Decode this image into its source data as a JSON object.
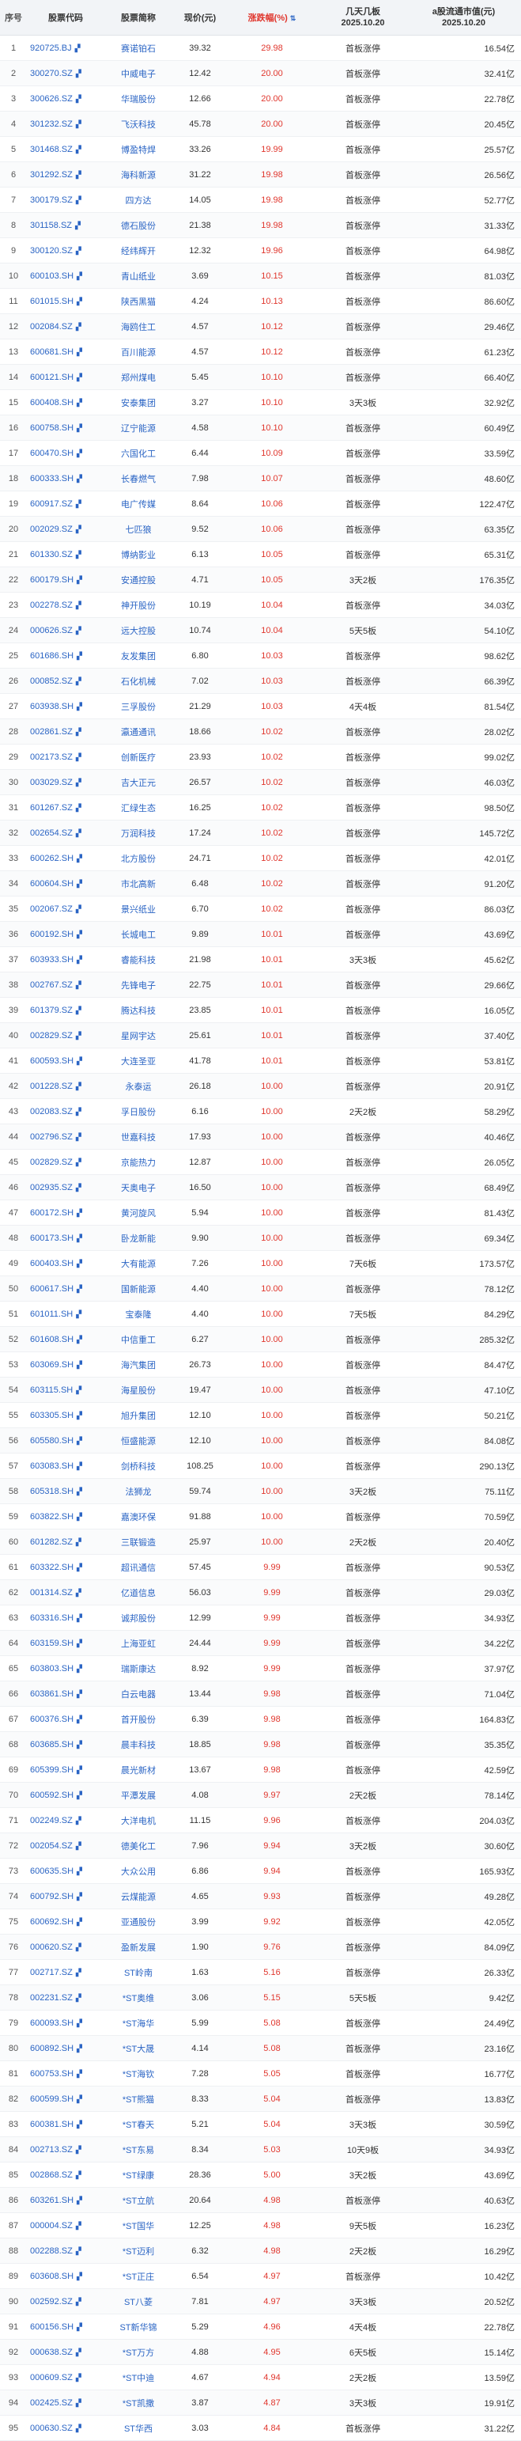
{
  "columns": {
    "idx": "序号",
    "code": "股票代码",
    "name": "股票简称",
    "price": "现价(元)",
    "pct": "涨跌幅(%)",
    "times": "几天几板\n2025.10.20",
    "mcap": "a股流通市值(元)\n2025.10.20",
    "sort_icon": "sort-arrow-icon"
  },
  "rows": [
    {
      "idx": "1",
      "code": "920725.BJ",
      "name": "赛诺铂石",
      "price": "39.32",
      "pct": "29.98",
      "times": "首板涨停",
      "mcap": "16.54亿"
    },
    {
      "idx": "2",
      "code": "300270.SZ",
      "name": "中威电子",
      "price": "12.42",
      "pct": "20.00",
      "times": "首板涨停",
      "mcap": "32.41亿"
    },
    {
      "idx": "3",
      "code": "300626.SZ",
      "name": "华瑞股份",
      "price": "12.66",
      "pct": "20.00",
      "times": "首板涨停",
      "mcap": "22.78亿"
    },
    {
      "idx": "4",
      "code": "301232.SZ",
      "name": "飞沃科技",
      "price": "45.78",
      "pct": "20.00",
      "times": "首板涨停",
      "mcap": "20.45亿"
    },
    {
      "idx": "5",
      "code": "301468.SZ",
      "name": "博盈特焊",
      "price": "33.26",
      "pct": "19.99",
      "times": "首板涨停",
      "mcap": "25.57亿"
    },
    {
      "idx": "6",
      "code": "301292.SZ",
      "name": "海科新源",
      "price": "31.22",
      "pct": "19.98",
      "times": "首板涨停",
      "mcap": "26.56亿"
    },
    {
      "idx": "7",
      "code": "300179.SZ",
      "name": "四方达",
      "price": "14.05",
      "pct": "19.98",
      "times": "首板涨停",
      "mcap": "52.77亿"
    },
    {
      "idx": "8",
      "code": "301158.SZ",
      "name": "德石股份",
      "price": "21.38",
      "pct": "19.98",
      "times": "首板涨停",
      "mcap": "31.33亿"
    },
    {
      "idx": "9",
      "code": "300120.SZ",
      "name": "经纬辉开",
      "price": "12.32",
      "pct": "19.96",
      "times": "首板涨停",
      "mcap": "64.98亿"
    },
    {
      "idx": "10",
      "code": "600103.SH",
      "name": "青山纸业",
      "price": "3.69",
      "pct": "10.15",
      "times": "首板涨停",
      "mcap": "81.03亿"
    },
    {
      "idx": "11",
      "code": "601015.SH",
      "name": "陕西黑猫",
      "price": "4.24",
      "pct": "10.13",
      "times": "首板涨停",
      "mcap": "86.60亿"
    },
    {
      "idx": "12",
      "code": "002084.SZ",
      "name": "海鸥住工",
      "price": "4.57",
      "pct": "10.12",
      "times": "首板涨停",
      "mcap": "29.46亿"
    },
    {
      "idx": "13",
      "code": "600681.SH",
      "name": "百川能源",
      "price": "4.57",
      "pct": "10.12",
      "times": "首板涨停",
      "mcap": "61.23亿"
    },
    {
      "idx": "14",
      "code": "600121.SH",
      "name": "郑州煤电",
      "price": "5.45",
      "pct": "10.10",
      "times": "首板涨停",
      "mcap": "66.40亿"
    },
    {
      "idx": "15",
      "code": "600408.SH",
      "name": "安泰集团",
      "price": "3.27",
      "pct": "10.10",
      "times": "3天3板",
      "mcap": "32.92亿"
    },
    {
      "idx": "16",
      "code": "600758.SH",
      "name": "辽宁能源",
      "price": "4.58",
      "pct": "10.10",
      "times": "首板涨停",
      "mcap": "60.49亿"
    },
    {
      "idx": "17",
      "code": "600470.SH",
      "name": "六国化工",
      "price": "6.44",
      "pct": "10.09",
      "times": "首板涨停",
      "mcap": "33.59亿"
    },
    {
      "idx": "18",
      "code": "600333.SH",
      "name": "长春燃气",
      "price": "7.98",
      "pct": "10.07",
      "times": "首板涨停",
      "mcap": "48.60亿"
    },
    {
      "idx": "19",
      "code": "600917.SZ",
      "name": "电广传媒",
      "price": "8.64",
      "pct": "10.06",
      "times": "首板涨停",
      "mcap": "122.47亿"
    },
    {
      "idx": "20",
      "code": "002029.SZ",
      "name": "七匹狼",
      "price": "9.52",
      "pct": "10.06",
      "times": "首板涨停",
      "mcap": "63.35亿"
    },
    {
      "idx": "21",
      "code": "601330.SZ",
      "name": "博纳影业",
      "price": "6.13",
      "pct": "10.05",
      "times": "首板涨停",
      "mcap": "65.31亿"
    },
    {
      "idx": "22",
      "code": "600179.SH",
      "name": "安通控股",
      "price": "4.71",
      "pct": "10.05",
      "times": "3天2板",
      "mcap": "176.35亿"
    },
    {
      "idx": "23",
      "code": "002278.SZ",
      "name": "神开股份",
      "price": "10.19",
      "pct": "10.04",
      "times": "首板涨停",
      "mcap": "34.03亿"
    },
    {
      "idx": "24",
      "code": "000626.SZ",
      "name": "远大控股",
      "price": "10.74",
      "pct": "10.04",
      "times": "5天5板",
      "mcap": "54.10亿"
    },
    {
      "idx": "25",
      "code": "601686.SH",
      "name": "友发集团",
      "price": "6.80",
      "pct": "10.03",
      "times": "首板涨停",
      "mcap": "98.62亿"
    },
    {
      "idx": "26",
      "code": "000852.SZ",
      "name": "石化机械",
      "price": "7.02",
      "pct": "10.03",
      "times": "首板涨停",
      "mcap": "66.39亿"
    },
    {
      "idx": "27",
      "code": "603938.SH",
      "name": "三孚股份",
      "price": "21.29",
      "pct": "10.03",
      "times": "4天4板",
      "mcap": "81.54亿"
    },
    {
      "idx": "28",
      "code": "002861.SZ",
      "name": "瀛通通讯",
      "price": "18.66",
      "pct": "10.02",
      "times": "首板涨停",
      "mcap": "28.02亿"
    },
    {
      "idx": "29",
      "code": "002173.SZ",
      "name": "创新医疗",
      "price": "23.93",
      "pct": "10.02",
      "times": "首板涨停",
      "mcap": "99.02亿"
    },
    {
      "idx": "30",
      "code": "003029.SZ",
      "name": "吉大正元",
      "price": "26.57",
      "pct": "10.02",
      "times": "首板涨停",
      "mcap": "46.03亿"
    },
    {
      "idx": "31",
      "code": "601267.SZ",
      "name": "汇绿生态",
      "price": "16.25",
      "pct": "10.02",
      "times": "首板涨停",
      "mcap": "98.50亿"
    },
    {
      "idx": "32",
      "code": "002654.SZ",
      "name": "万润科技",
      "price": "17.24",
      "pct": "10.02",
      "times": "首板涨停",
      "mcap": "145.72亿"
    },
    {
      "idx": "33",
      "code": "600262.SH",
      "name": "北方股份",
      "price": "24.71",
      "pct": "10.02",
      "times": "首板涨停",
      "mcap": "42.01亿"
    },
    {
      "idx": "34",
      "code": "600604.SH",
      "name": "市北高新",
      "price": "6.48",
      "pct": "10.02",
      "times": "首板涨停",
      "mcap": "91.20亿"
    },
    {
      "idx": "35",
      "code": "002067.SZ",
      "name": "景兴纸业",
      "price": "6.70",
      "pct": "10.02",
      "times": "首板涨停",
      "mcap": "86.03亿"
    },
    {
      "idx": "36",
      "code": "600192.SH",
      "name": "长城电工",
      "price": "9.89",
      "pct": "10.01",
      "times": "首板涨停",
      "mcap": "43.69亿"
    },
    {
      "idx": "37",
      "code": "603933.SH",
      "name": "睿能科技",
      "price": "21.98",
      "pct": "10.01",
      "times": "3天3板",
      "mcap": "45.62亿"
    },
    {
      "idx": "38",
      "code": "002767.SZ",
      "name": "先锋电子",
      "price": "22.75",
      "pct": "10.01",
      "times": "首板涨停",
      "mcap": "29.66亿"
    },
    {
      "idx": "39",
      "code": "601379.SZ",
      "name": "腾达科技",
      "price": "23.85",
      "pct": "10.01",
      "times": "首板涨停",
      "mcap": "16.05亿"
    },
    {
      "idx": "40",
      "code": "002829.SZ",
      "name": "星网宇达",
      "price": "25.61",
      "pct": "10.01",
      "times": "首板涨停",
      "mcap": "37.40亿"
    },
    {
      "idx": "41",
      "code": "600593.SH",
      "name": "大连圣亚",
      "price": "41.78",
      "pct": "10.01",
      "times": "首板涨停",
      "mcap": "53.81亿"
    },
    {
      "idx": "42",
      "code": "001228.SZ",
      "name": "永泰运",
      "price": "26.18",
      "pct": "10.00",
      "times": "首板涨停",
      "mcap": "20.91亿"
    },
    {
      "idx": "43",
      "code": "002083.SZ",
      "name": "孚日股份",
      "price": "6.16",
      "pct": "10.00",
      "times": "2天2板",
      "mcap": "58.29亿"
    },
    {
      "idx": "44",
      "code": "002796.SZ",
      "name": "世嘉科技",
      "price": "17.93",
      "pct": "10.00",
      "times": "首板涨停",
      "mcap": "40.46亿"
    },
    {
      "idx": "45",
      "code": "002829.SZ",
      "name": "京能热力",
      "price": "12.87",
      "pct": "10.00",
      "times": "首板涨停",
      "mcap": "26.05亿"
    },
    {
      "idx": "46",
      "code": "002935.SZ",
      "name": "天奥电子",
      "price": "16.50",
      "pct": "10.00",
      "times": "首板涨停",
      "mcap": "68.49亿"
    },
    {
      "idx": "47",
      "code": "600172.SH",
      "name": "黄河旋风",
      "price": "5.94",
      "pct": "10.00",
      "times": "首板涨停",
      "mcap": "81.43亿"
    },
    {
      "idx": "48",
      "code": "600173.SH",
      "name": "卧龙新能",
      "price": "9.90",
      "pct": "10.00",
      "times": "首板涨停",
      "mcap": "69.34亿"
    },
    {
      "idx": "49",
      "code": "600403.SH",
      "name": "大有能源",
      "price": "7.26",
      "pct": "10.00",
      "times": "7天6板",
      "mcap": "173.57亿"
    },
    {
      "idx": "50",
      "code": "600617.SH",
      "name": "国新能源",
      "price": "4.40",
      "pct": "10.00",
      "times": "首板涨停",
      "mcap": "78.12亿"
    },
    {
      "idx": "51",
      "code": "601011.SH",
      "name": "宝泰隆",
      "price": "4.40",
      "pct": "10.00",
      "times": "7天5板",
      "mcap": "84.29亿"
    },
    {
      "idx": "52",
      "code": "601608.SH",
      "name": "中信重工",
      "price": "6.27",
      "pct": "10.00",
      "times": "首板涨停",
      "mcap": "285.32亿"
    },
    {
      "idx": "53",
      "code": "603069.SH",
      "name": "海汽集团",
      "price": "26.73",
      "pct": "10.00",
      "times": "首板涨停",
      "mcap": "84.47亿"
    },
    {
      "idx": "54",
      "code": "603115.SH",
      "name": "海星股份",
      "price": "19.47",
      "pct": "10.00",
      "times": "首板涨停",
      "mcap": "47.10亿"
    },
    {
      "idx": "55",
      "code": "603305.SH",
      "name": "旭升集团",
      "price": "12.10",
      "pct": "10.00",
      "times": "首板涨停",
      "mcap": "50.21亿"
    },
    {
      "idx": "56",
      "code": "605580.SH",
      "name": "恒盛能源",
      "price": "12.10",
      "pct": "10.00",
      "times": "首板涨停",
      "mcap": "84.08亿"
    },
    {
      "idx": "57",
      "code": "603083.SH",
      "name": "剑桥科技",
      "price": "108.25",
      "pct": "10.00",
      "times": "首板涨停",
      "mcap": "290.13亿"
    },
    {
      "idx": "58",
      "code": "605318.SH",
      "name": "法狮龙",
      "price": "59.74",
      "pct": "10.00",
      "times": "3天2板",
      "mcap": "75.11亿"
    },
    {
      "idx": "59",
      "code": "603822.SH",
      "name": "嘉澳环保",
      "price": "91.88",
      "pct": "10.00",
      "times": "首板涨停",
      "mcap": "70.59亿"
    },
    {
      "idx": "60",
      "code": "601282.SZ",
      "name": "三联锻造",
      "price": "25.97",
      "pct": "10.00",
      "times": "2天2板",
      "mcap": "20.40亿"
    },
    {
      "idx": "61",
      "code": "603322.SH",
      "name": "超讯通信",
      "price": "57.45",
      "pct": "9.99",
      "times": "首板涨停",
      "mcap": "90.53亿"
    },
    {
      "idx": "62",
      "code": "001314.SZ",
      "name": "亿道信息",
      "price": "56.03",
      "pct": "9.99",
      "times": "首板涨停",
      "mcap": "29.03亿"
    },
    {
      "idx": "63",
      "code": "603316.SH",
      "name": "诚邦股份",
      "price": "12.99",
      "pct": "9.99",
      "times": "首板涨停",
      "mcap": "34.93亿"
    },
    {
      "idx": "64",
      "code": "603159.SH",
      "name": "上海亚虹",
      "price": "24.44",
      "pct": "9.99",
      "times": "首板涨停",
      "mcap": "34.22亿"
    },
    {
      "idx": "65",
      "code": "603803.SH",
      "name": "瑞斯康达",
      "price": "8.92",
      "pct": "9.99",
      "times": "首板涨停",
      "mcap": "37.97亿"
    },
    {
      "idx": "66",
      "code": "603861.SH",
      "name": "白云电器",
      "price": "13.44",
      "pct": "9.98",
      "times": "首板涨停",
      "mcap": "71.04亿"
    },
    {
      "idx": "67",
      "code": "600376.SH",
      "name": "首开股份",
      "price": "6.39",
      "pct": "9.98",
      "times": "首板涨停",
      "mcap": "164.83亿"
    },
    {
      "idx": "68",
      "code": "603685.SH",
      "name": "晨丰科技",
      "price": "18.85",
      "pct": "9.98",
      "times": "首板涨停",
      "mcap": "35.35亿"
    },
    {
      "idx": "69",
      "code": "605399.SH",
      "name": "晨光新材",
      "price": "13.67",
      "pct": "9.98",
      "times": "首板涨停",
      "mcap": "42.59亿"
    },
    {
      "idx": "70",
      "code": "600592.SH",
      "name": "平潭发展",
      "price": "4.08",
      "pct": "9.97",
      "times": "2天2板",
      "mcap": "78.14亿"
    },
    {
      "idx": "71",
      "code": "002249.SZ",
      "name": "大洋电机",
      "price": "11.15",
      "pct": "9.96",
      "times": "首板涨停",
      "mcap": "204.03亿"
    },
    {
      "idx": "72",
      "code": "002054.SZ",
      "name": "德美化工",
      "price": "7.96",
      "pct": "9.94",
      "times": "3天2板",
      "mcap": "30.60亿"
    },
    {
      "idx": "73",
      "code": "600635.SH",
      "name": "大众公用",
      "price": "6.86",
      "pct": "9.94",
      "times": "首板涨停",
      "mcap": "165.93亿"
    },
    {
      "idx": "74",
      "code": "600792.SH",
      "name": "云煤能源",
      "price": "4.65",
      "pct": "9.93",
      "times": "首板涨停",
      "mcap": "49.28亿"
    },
    {
      "idx": "75",
      "code": "600692.SH",
      "name": "亚通股份",
      "price": "3.99",
      "pct": "9.92",
      "times": "首板涨停",
      "mcap": "42.05亿"
    },
    {
      "idx": "76",
      "code": "000620.SZ",
      "name": "盈新发展",
      "price": "1.90",
      "pct": "9.76",
      "times": "首板涨停",
      "mcap": "84.09亿"
    },
    {
      "idx": "77",
      "code": "002717.SZ",
      "name": "ST岭南",
      "price": "1.63",
      "pct": "5.16",
      "times": "首板涨停",
      "mcap": "26.33亿"
    },
    {
      "idx": "78",
      "code": "002231.SZ",
      "name": "*ST奥维",
      "price": "3.06",
      "pct": "5.15",
      "times": "5天5板",
      "mcap": "9.42亿"
    },
    {
      "idx": "79",
      "code": "600093.SH",
      "name": "*ST海华",
      "price": "5.99",
      "pct": "5.08",
      "times": "首板涨停",
      "mcap": "24.49亿"
    },
    {
      "idx": "80",
      "code": "600892.SH",
      "name": "*ST大晟",
      "price": "4.14",
      "pct": "5.08",
      "times": "首板涨停",
      "mcap": "23.16亿"
    },
    {
      "idx": "81",
      "code": "600753.SH",
      "name": "*ST海钦",
      "price": "7.28",
      "pct": "5.05",
      "times": "首板涨停",
      "mcap": "16.77亿"
    },
    {
      "idx": "82",
      "code": "600599.SH",
      "name": "*ST熊猫",
      "price": "8.33",
      "pct": "5.04",
      "times": "首板涨停",
      "mcap": "13.83亿"
    },
    {
      "idx": "83",
      "code": "600381.SH",
      "name": "*ST春天",
      "price": "5.21",
      "pct": "5.04",
      "times": "3天3板",
      "mcap": "30.59亿"
    },
    {
      "idx": "84",
      "code": "002713.SZ",
      "name": "*ST东易",
      "price": "8.34",
      "pct": "5.03",
      "times": "10天9板",
      "mcap": "34.93亿"
    },
    {
      "idx": "85",
      "code": "002868.SZ",
      "name": "*ST绿康",
      "price": "28.36",
      "pct": "5.00",
      "times": "3天2板",
      "mcap": "43.69亿"
    },
    {
      "idx": "86",
      "code": "603261.SH",
      "name": "*ST立航",
      "price": "20.64",
      "pct": "4.98",
      "times": "首板涨停",
      "mcap": "40.63亿"
    },
    {
      "idx": "87",
      "code": "000004.SZ",
      "name": "*ST国华",
      "price": "12.25",
      "pct": "4.98",
      "times": "9天5板",
      "mcap": "16.23亿"
    },
    {
      "idx": "88",
      "code": "002288.SZ",
      "name": "*ST迈利",
      "price": "6.32",
      "pct": "4.98",
      "times": "2天2板",
      "mcap": "16.29亿"
    },
    {
      "idx": "89",
      "code": "603608.SH",
      "name": "*ST正庄",
      "price": "6.54",
      "pct": "4.97",
      "times": "首板涨停",
      "mcap": "10.42亿"
    },
    {
      "idx": "90",
      "code": "002592.SZ",
      "name": "ST八菱",
      "price": "7.81",
      "pct": "4.97",
      "times": "3天3板",
      "mcap": "20.52亿"
    },
    {
      "idx": "91",
      "code": "600156.SH",
      "name": "ST新华锦",
      "price": "5.29",
      "pct": "4.96",
      "times": "4天4板",
      "mcap": "22.78亿"
    },
    {
      "idx": "92",
      "code": "000638.SZ",
      "name": "*ST万方",
      "price": "4.88",
      "pct": "4.95",
      "times": "6天5板",
      "mcap": "15.14亿"
    },
    {
      "idx": "93",
      "code": "000609.SZ",
      "name": "*ST中迪",
      "price": "4.67",
      "pct": "4.94",
      "times": "2天2板",
      "mcap": "13.59亿"
    },
    {
      "idx": "94",
      "code": "002425.SZ",
      "name": "*ST凯撒",
      "price": "3.87",
      "pct": "4.87",
      "times": "3天3板",
      "mcap": "19.91亿"
    },
    {
      "idx": "95",
      "code": "000630.SZ",
      "name": "ST华西",
      "price": "3.03",
      "pct": "4.84",
      "times": "首板涨停",
      "mcap": "31.22亿"
    }
  ]
}
